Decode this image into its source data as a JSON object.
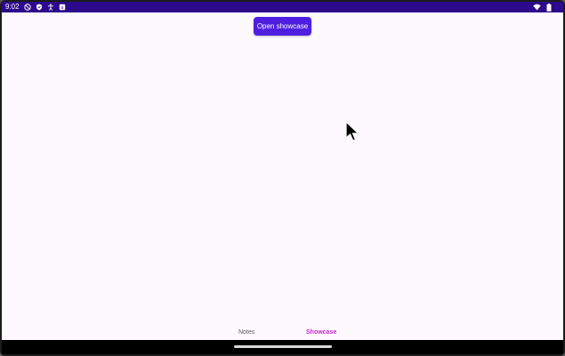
{
  "status_bar": {
    "time": "9:02",
    "left_icons": [
      "do-not-disturb-icon",
      "shield-icon",
      "accessibility-icon",
      "notification-square-icon"
    ],
    "right_icons": [
      "wifi-icon",
      "battery-icon"
    ],
    "background": "#2d0a8c"
  },
  "main": {
    "open_button_label": "Open showcase",
    "button_color": "#4e1fe0"
  },
  "bottom_nav": {
    "items": [
      {
        "label": "Notes",
        "selected": false
      },
      {
        "label": "Showcase",
        "selected": true
      }
    ],
    "selected_color": "#c327c9"
  }
}
